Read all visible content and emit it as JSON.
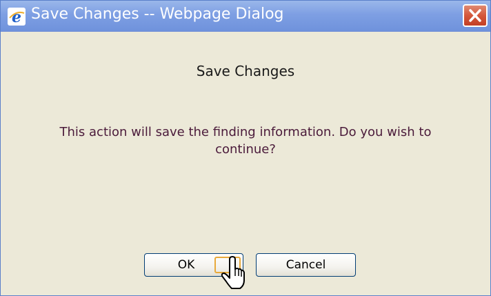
{
  "window": {
    "title": "Save Changes -- Webpage Dialog",
    "icon": "ie-icon",
    "close_icon": "close-icon"
  },
  "dialog": {
    "heading": "Save Changes",
    "message": "This action will save the finding information. Do you wish to continue?"
  },
  "buttons": {
    "ok_label": "OK",
    "cancel_label": "Cancel"
  },
  "colors": {
    "titlebar": "#7e9fe3",
    "background": "#ece9d8",
    "close": "#d4573b",
    "message_text": "#4a1a3a"
  }
}
